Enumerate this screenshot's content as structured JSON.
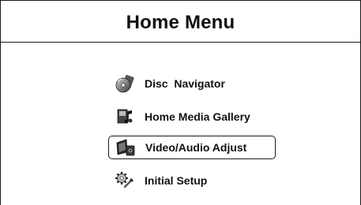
{
  "header": {
    "title": "Home Menu"
  },
  "menu": {
    "selected_index": 2,
    "items": [
      {
        "label": "Disc  Navigator",
        "icon": "disc-navigator-icon"
      },
      {
        "label": "Home Media Gallery",
        "icon": "media-gallery-icon"
      },
      {
        "label": "Video/Audio Adjust",
        "icon": "video-audio-adjust-icon"
      },
      {
        "label": "Initial Setup",
        "icon": "initial-setup-icon"
      }
    ]
  },
  "colors": {
    "background": "#ffffff",
    "foreground": "#111111",
    "border": "#1a1a1a"
  }
}
